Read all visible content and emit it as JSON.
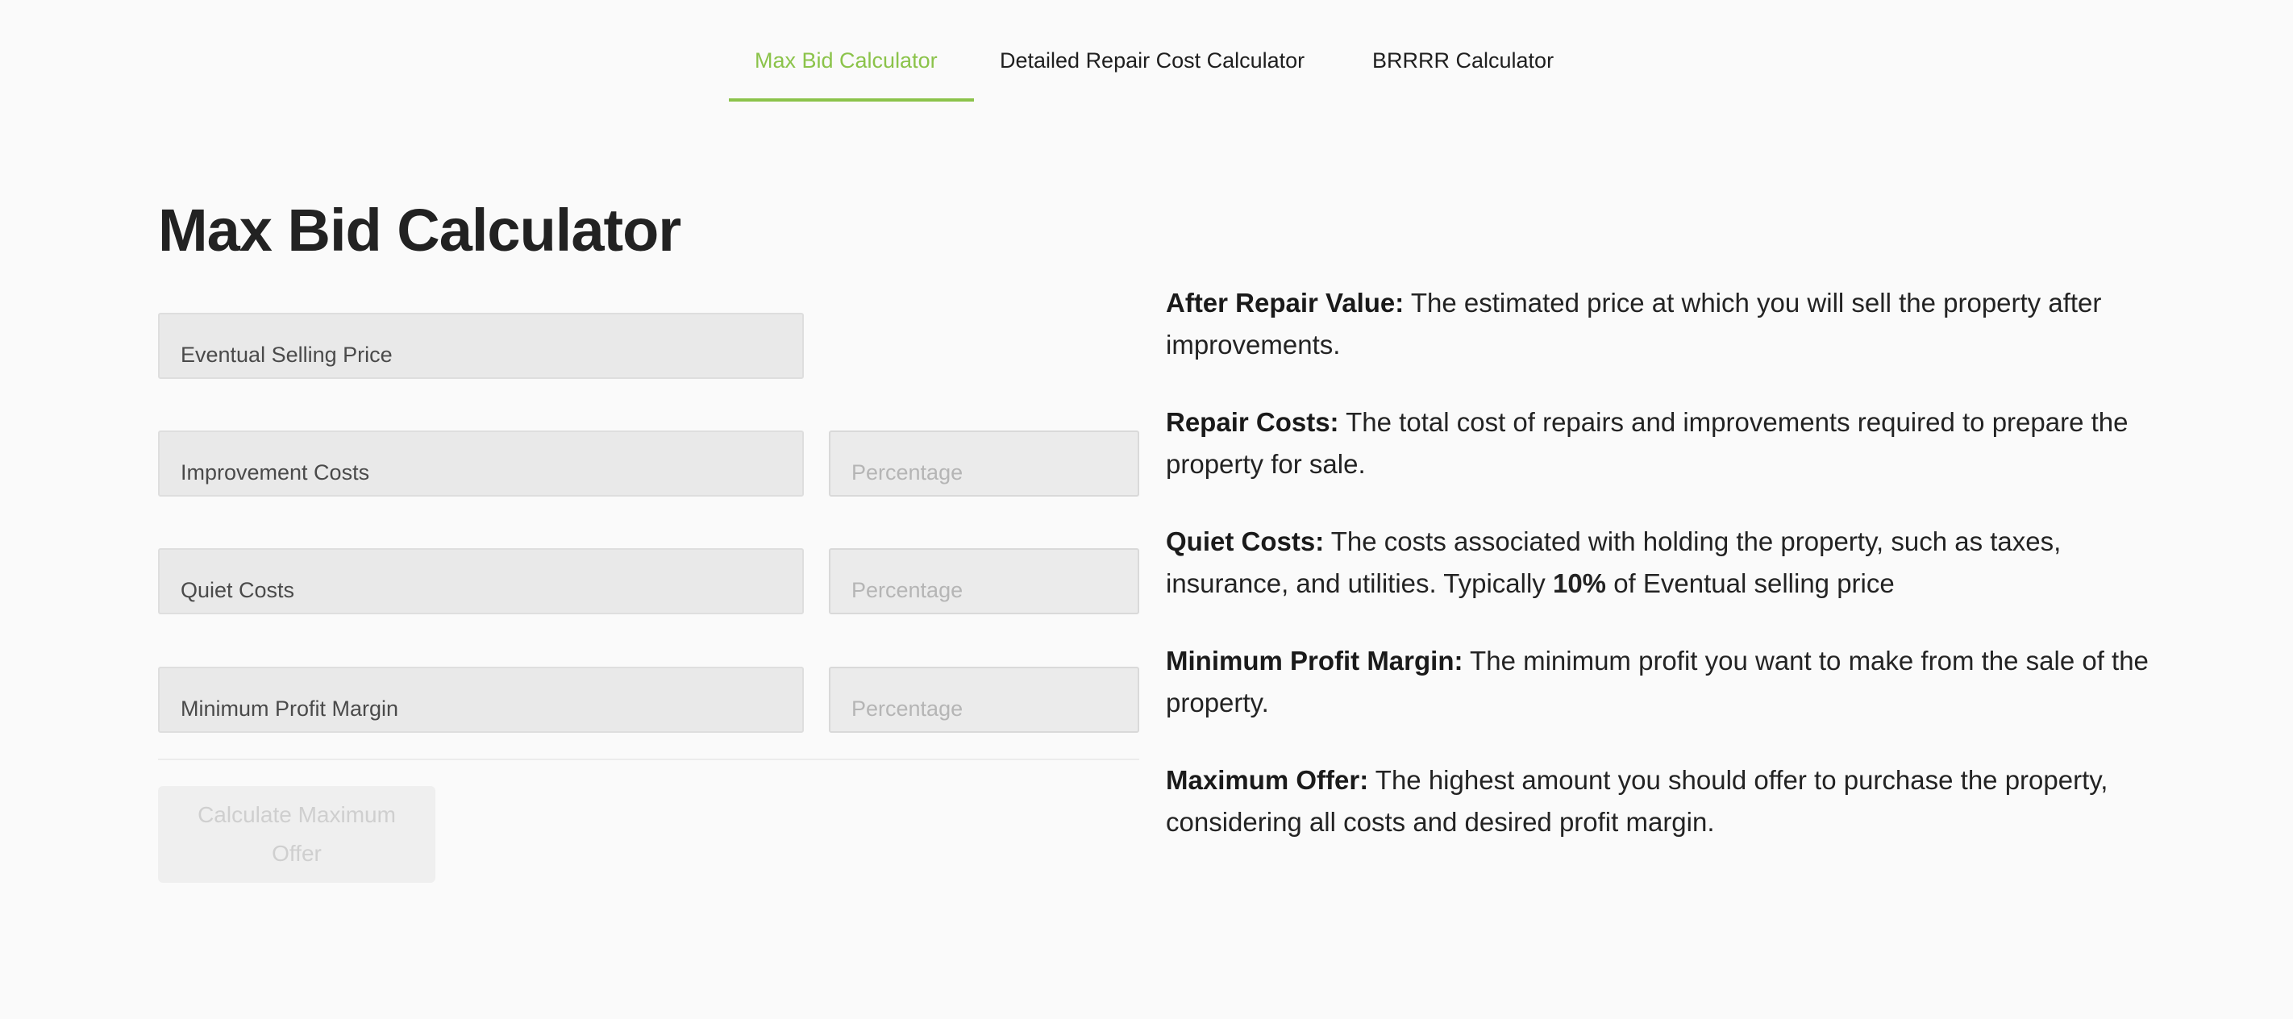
{
  "tabs": [
    {
      "label": "Max Bid Calculator",
      "active": true
    },
    {
      "label": "Detailed Repair Cost Calculator",
      "active": false
    },
    {
      "label": "BRRRR Calculator",
      "active": false
    }
  ],
  "page": {
    "title": "Max Bid Calculator"
  },
  "form": {
    "selling_price_placeholder": "Eventual Selling Price",
    "improvement_costs_placeholder": "Improvement Costs",
    "improvement_pct_placeholder": "Percentage",
    "quiet_costs_placeholder": "Quiet Costs",
    "quiet_pct_placeholder": "Percentage",
    "profit_margin_placeholder": "Minimum Profit Margin",
    "profit_pct_placeholder": "Percentage",
    "submit_label": "Calculate Maximum Offer",
    "submit_disabled": true
  },
  "descriptions": [
    {
      "term": "After Repair Value:",
      "text": " The estimated price at which you will sell the property after improvements."
    },
    {
      "term": "Repair Costs:",
      "text": " The total cost of repairs and improvements required to prepare the property for sale."
    },
    {
      "term": "Quiet Costs:",
      "text_before": " The costs associated with holding the property, such as taxes, insurance, and utilities. Typically ",
      "emphasis": "10%",
      "text_after": " of Eventual selling price"
    },
    {
      "term": "Minimum Profit Margin:",
      "text": " The minimum profit you want to make from the sale of the property."
    },
    {
      "term": "Maximum Offer:",
      "text": " The highest amount you should offer to purchase the property, considering all costs and desired profit margin."
    }
  ],
  "colors": {
    "accent": "#8bc34a",
    "background": "#fafafa",
    "field_background": "#e9e9e9"
  }
}
